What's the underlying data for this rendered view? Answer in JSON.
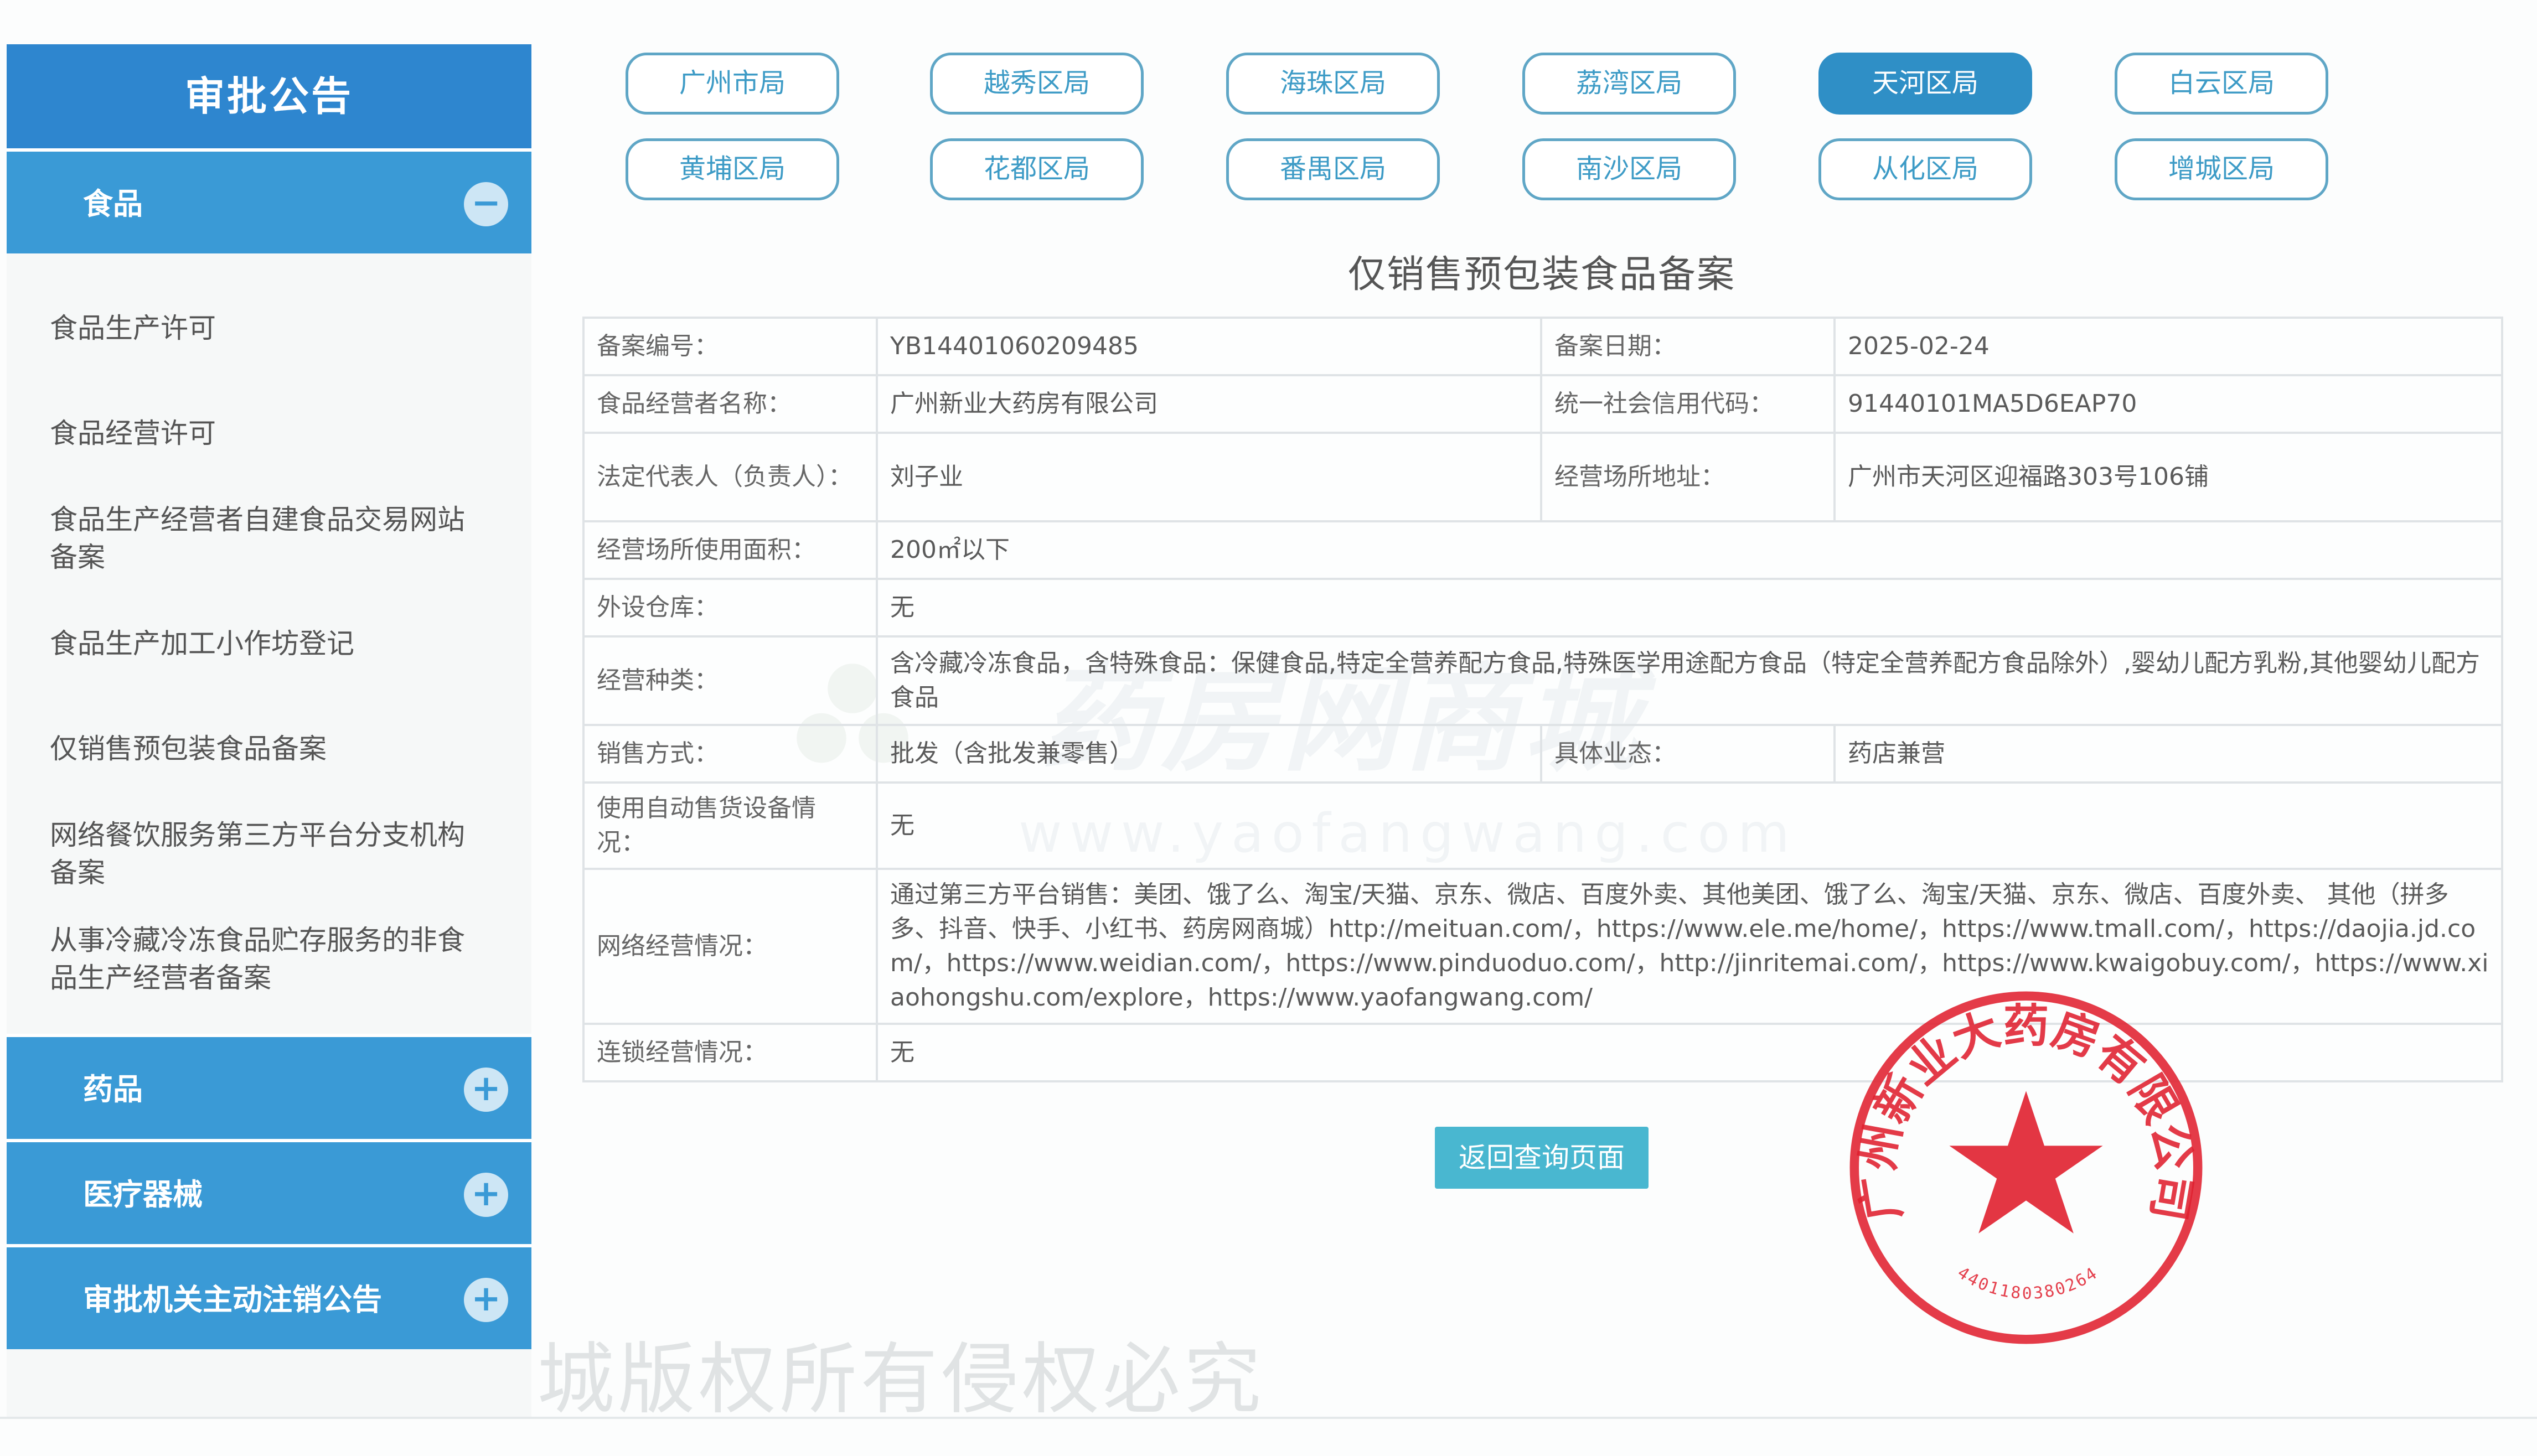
{
  "sidebar": {
    "title": "审批公告",
    "categories": {
      "food": {
        "label": "食品",
        "toggle": "−"
      },
      "drug": {
        "label": "药品",
        "toggle": "+"
      },
      "device": {
        "label": "医疗器械",
        "toggle": "+"
      },
      "cancel": {
        "label": "审批机关主动注销公告",
        "toggle": "+"
      }
    },
    "food_items": [
      "食品生产许可",
      "食品经营许可",
      "食品生产经营者自建食品交易网站备案",
      "食品生产加工小作坊登记",
      "仅销售预包装食品备案",
      "网络餐饮服务第三方平台分支机构备案",
      "从事冷藏冷冻食品贮存服务的非食品生产经营者备案"
    ]
  },
  "districts": {
    "row1": [
      "广州市局",
      "越秀区局",
      "海珠区局",
      "荔湾区局",
      "天河区局",
      "白云区局"
    ],
    "row2": [
      "黄埔区局",
      "花都区局",
      "番禺区局",
      "南沙区局",
      "从化区局",
      "增城区局"
    ],
    "active": "天河区局"
  },
  "page": {
    "title": "仅销售预包装食品备案",
    "return_button": "返回查询页面"
  },
  "record": {
    "filing_no_label": "备案编号：",
    "filing_no": "YB14401060209485",
    "filing_date_label": "备案日期：",
    "filing_date": "2025-02-24",
    "operator_name_label": "食品经营者名称：",
    "operator_name": "广州新业大药房有限公司",
    "credit_code_label": "统一社会信用代码：",
    "credit_code": "91440101MA5D6EAP70",
    "legal_rep_label": "法定代表人（负责人）：",
    "legal_rep": "刘子业",
    "address_label": "经营场所地址：",
    "address": "广州市天河区迎福路303号106铺",
    "area_label": "经营场所使用面积：",
    "area": "200㎡以下",
    "warehouse_label": "外设仓库：",
    "warehouse": "无",
    "category_label": "经营种类：",
    "category": "含冷藏冷冻食品，含特殊食品：保健食品,特定全营养配方食品,特殊医学用途配方食品（特定全营养配方食品除外）,婴幼儿配方乳粉,其他婴幼儿配方食品",
    "sales_mode_label": "销售方式：",
    "sales_mode": "批发（含批发兼零售）",
    "business_form_label": "具体业态：",
    "business_form": "药店兼营",
    "vending_label": "使用自动售货设备情况：",
    "vending": "无",
    "online_label": "网络经营情况：",
    "online": "通过第三方平台销售：美团、饿了么、淘宝/天猫、京东、微店、百度外卖、其他美团、饿了么、淘宝/天猫、京东、微店、百度外卖、 其他（拼多多、抖音、快手、小红书、药房网商城）http://meituan.com/，https://www.ele.me/home/，https://www.tmall.com/，https://daojia.jd.com/，https://www.weidian.com/，https://www.pinduoduo.com/，http://jinritemai.com/，https://www.kwaigobuy.com/，https://www.xiaohongshu.com/explore，https://www.yaofangwang.com/",
    "chain_label": "连锁经营情况：",
    "chain": "无"
  },
  "watermark": {
    "brand": "药房网商城",
    "url": "www.yaofangwang.com",
    "copyright": "城版权所有侵权必究"
  },
  "seal": {
    "text": "广州新业大药房有限公司",
    "code": "4401180380264"
  },
  "colors": {
    "sidebar_title": "#2e86cf",
    "sidebar_category": "#3a9ad6",
    "active_district": "#2f8fc6",
    "district_border": "#5fa6c6",
    "return_button": "#49b7d0",
    "seal_red": "#e0202f"
  }
}
